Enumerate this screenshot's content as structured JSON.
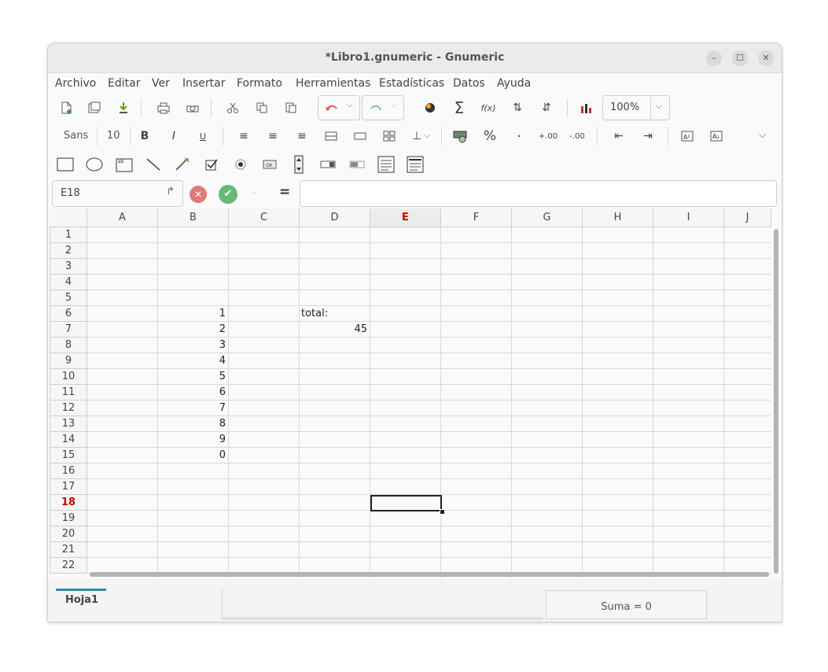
{
  "window": {
    "title": "*Libro1.gnumeric - Gnumeric",
    "minimize": "–",
    "maximize": "☐",
    "close": "✕"
  },
  "menu": [
    "Archivo",
    "Editar",
    "Ver",
    "Insertar",
    "Formato",
    "Herramientas",
    "Estadísticas",
    "Datos",
    "Ayuda"
  ],
  "toolbar": {
    "zoom": "100%",
    "font_name": "Sans",
    "font_size": "10",
    "bold": "B",
    "italic": "I",
    "underline": "U",
    "percent": "%",
    "fx": "f(x)"
  },
  "formula_bar": {
    "cell_ref": "E18",
    "equals": "=",
    "value": ""
  },
  "columns": [
    "A",
    "B",
    "C",
    "D",
    "E",
    "F",
    "G",
    "H",
    "I",
    "J"
  ],
  "active_column": "E",
  "rows": [
    "1",
    "2",
    "3",
    "4",
    "5",
    "6",
    "7",
    "8",
    "9",
    "10",
    "11",
    "12",
    "13",
    "14",
    "15",
    "16",
    "17",
    "18",
    "19",
    "20",
    "21",
    "22"
  ],
  "active_row": "18",
  "cells": [
    {
      "ref": "B6",
      "col": "B",
      "row": 6,
      "value": "1",
      "align": "right"
    },
    {
      "ref": "B7",
      "col": "B",
      "row": 7,
      "value": "2",
      "align": "right"
    },
    {
      "ref": "B8",
      "col": "B",
      "row": 8,
      "value": "3",
      "align": "right"
    },
    {
      "ref": "B9",
      "col": "B",
      "row": 9,
      "value": "4",
      "align": "right"
    },
    {
      "ref": "B10",
      "col": "B",
      "row": 10,
      "value": "5",
      "align": "right"
    },
    {
      "ref": "B11",
      "col": "B",
      "row": 11,
      "value": "6",
      "align": "right"
    },
    {
      "ref": "B12",
      "col": "B",
      "row": 12,
      "value": "7",
      "align": "right"
    },
    {
      "ref": "B13",
      "col": "B",
      "row": 13,
      "value": "8",
      "align": "right"
    },
    {
      "ref": "B14",
      "col": "B",
      "row": 14,
      "value": "9",
      "align": "right"
    },
    {
      "ref": "B15",
      "col": "B",
      "row": 15,
      "value": "0",
      "align": "right"
    },
    {
      "ref": "D6",
      "col": "D",
      "row": 6,
      "value": "total:",
      "align": "left"
    },
    {
      "ref": "D7",
      "col": "D",
      "row": 7,
      "value": "45",
      "align": "right"
    }
  ],
  "sheet_tab": "Hoja1",
  "status": "Suma = 0",
  "colors": {
    "accent": "#2b8a9a",
    "active_header": "#cc0000",
    "cancel": "#e07a7a",
    "accept": "#5cb85c",
    "undo": "#d9534f",
    "redo": "#7ec48b",
    "grid": "#d9d9d9"
  }
}
